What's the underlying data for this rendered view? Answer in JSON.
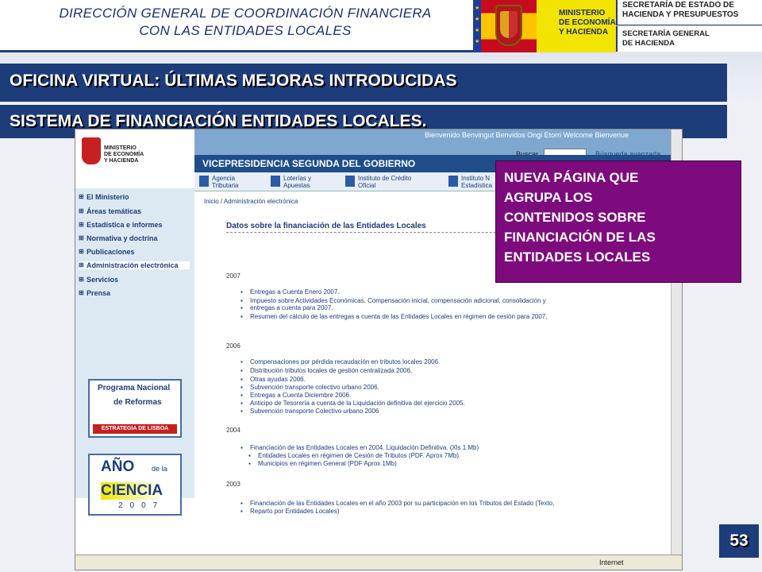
{
  "header": {
    "org_title_line1": "DIRECCIÓN GENERAL DE COORDINACIÓN FINANCIERA",
    "org_title_line2": "CON LAS ENTIDADES LOCALES",
    "ministry_line1": "MINISTERIO",
    "ministry_line2": "DE ECONOMÍA",
    "ministry_line3": "Y HACIENDA",
    "sec1_line1": "SECRETARÍA DE ESTADO DE",
    "sec1_line2": "HACIENDA Y PRESUPUESTOS",
    "sec2_line1": "SECRETARÍA GENERAL",
    "sec2_line2": "DE HACIENDA"
  },
  "bars": {
    "title1": "OFICINA VIRTUAL: ÚLTIMAS MEJORAS INTRODUCIDAS",
    "title2": "SISTEMA DE FINANCIACIÓN ENTIDADES LOCALES."
  },
  "site": {
    "logo_line1": "MINISTERIO",
    "logo_line2": "DE ECONOMÍA",
    "logo_line3": "Y HACIENDA",
    "top_menu": "Bienvenido  Benvingut  Benvidos  Ongi Etorri  Welcome  Bienvenue",
    "search_label": "Buscar",
    "search_advanced": "Búsqueda avanzada",
    "banner": "VICEPRESIDENCIA SEGUNDA DEL GOBIERNO",
    "link_bar": [
      {
        "line1": "Agencia",
        "line2": "Tributaria"
      },
      {
        "line1": "Loterías y",
        "line2": "Apuestas"
      },
      {
        "line1": "Instituto de Crédito",
        "line2": "Oficial"
      },
      {
        "line1": "Instituto N",
        "line2": "Estadística"
      }
    ],
    "sidebar": [
      "El Ministerio",
      "Áreas temáticas",
      "Estadística e informes",
      "Normativa y doctrina",
      "Publicaciones",
      "Administración electrónica",
      "Servicios",
      "Prensa"
    ],
    "banner1": {
      "line1": "Programa Nacional",
      "line2": "de Reformas",
      "strip": "ESTRATEGIA DE LISBOA"
    },
    "banner2": {
      "line1": "AÑO",
      "dela": "de la",
      "line2": "CIENCIA",
      "year": "2007"
    },
    "breadcrumb": "Inicio / Administración electrónica",
    "page_title": "Datos sobre la financiación de las Entidades Locales",
    "sections": [
      {
        "year": "2007",
        "items": [
          "Entregas a Cuenta Enero 2007.",
          "Impuesto sobre Actividades Económicas. Compensación inicial, compensación adicional, consolidación y",
          "entregas a cuenta para 2007.",
          "Resumen del cálculo de las entregas a cuenta de las Entidades Locales en régimen de cesión para 2007."
        ]
      },
      {
        "year": "2006",
        "items": [
          "Compensaciones por pérdida recaudación en tributos locales 2006.",
          "Distribución tributos locales de gestión centralizada 2006.",
          "Otras ayudas 2006.",
          "Subvención transporte colectivo urbano 2006.",
          "Entregas a Cuenta Diciembre 2006.",
          "Anticipo de Tesorería a cuenta de la Liquidación definitiva del ejercicio 2005.",
          "Subvención transporte Colectivo urbano 2006"
        ]
      },
      {
        "year": "2004",
        "items": [
          "Financiación de las Entidades Locales en 2004. Liquidación Definitiva. (Xls 1 Mb)",
          "Entidades Locales en régimen de Cesión de Tributos (PDF. Aprox 7Mb)",
          "Municipios en régimen General (PDF Aprox 1Mb)"
        ]
      },
      {
        "year": "2003",
        "items": [
          "Financiación de las Entidades Locales en el año 2003 por su participación en los Tributos del Estado (Texto,",
          "Reparto por Entidades Locales)"
        ]
      }
    ],
    "status": "Internet"
  },
  "callout": {
    "line1": "NUEVA PÁGINA QUE",
    "line2": "AGRUPA LOS",
    "line3": "CONTENIDOS SOBRE",
    "line4": "FINANCIACIÓN DE LAS",
    "line5": "ENTIDADES LOCALES"
  },
  "page_number": "53",
  "colors": {
    "navy": "#1d3c7a",
    "callout": "#7d0b7d",
    "ministry_yellow": "#f3e400"
  }
}
